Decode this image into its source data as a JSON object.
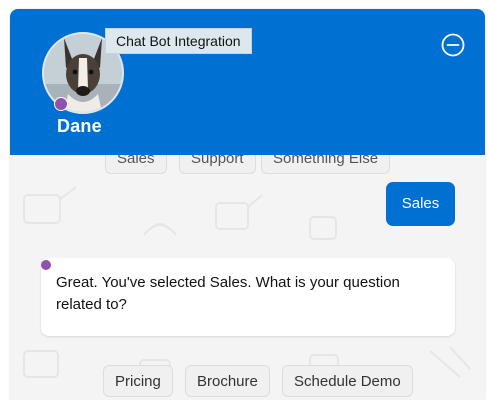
{
  "window": {
    "title": "Chat Bot Integration"
  },
  "header": {
    "bot_name": "Dane",
    "avatar_icon": "dog-avatar",
    "minimize_icon": "minus-circle-icon",
    "background_color": "#0070d2",
    "status_color": "#9050b0"
  },
  "menu_options": [
    "Sales",
    "Support",
    "Something Else"
  ],
  "messages": {
    "user_reply": "Sales",
    "bot_reply": "Great. You've selected Sales. What is your question related to?"
  },
  "quick_replies": [
    "Pricing",
    "Brochure",
    "Schedule Demo"
  ]
}
